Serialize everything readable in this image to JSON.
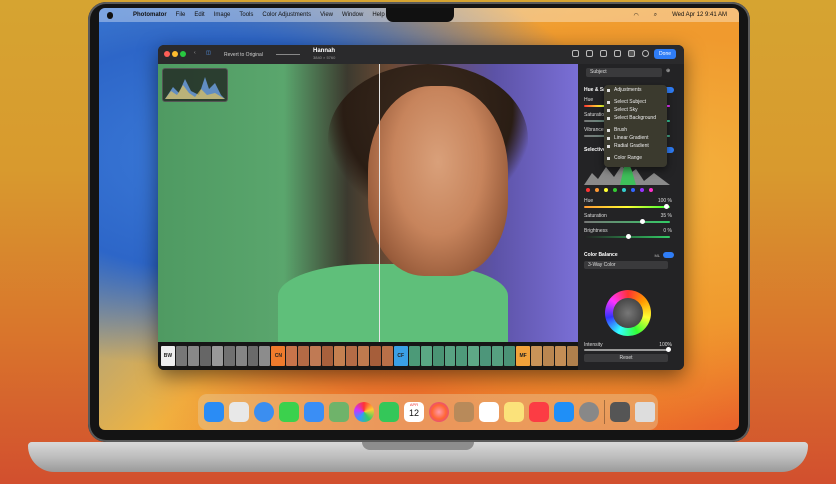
{
  "menubar": {
    "app": "Photomator",
    "items": [
      "File",
      "Edit",
      "Image",
      "Tools",
      "Color Adjustments",
      "View",
      "Window",
      "Help"
    ],
    "clock": "Wed Apr 12  9:41 AM"
  },
  "toolbar": {
    "revert": "Revert to Original",
    "photo_title": "Hannah",
    "photo_size": "3840 × 5760",
    "done": "Done"
  },
  "panel": {
    "subject": "Subject",
    "hue_saturation": "Hue & Saturation",
    "hue": "Hue",
    "saturation": "Saturation",
    "vibrance": "Vibrance",
    "ml": "ML",
    "selective_color": "Selective Color",
    "sc_hue": "Hue",
    "sc_hue_val": "100 %",
    "sc_saturation": "Saturation",
    "sc_saturation_val": "35 %",
    "sc_brightness": "Brightness",
    "sc_brightness_val": "0 %",
    "color_balance": "Color Balance",
    "three_way": "3-Way Color",
    "intensity": "Intensity",
    "intensity_val": "100%",
    "reset": "Reset"
  },
  "dropdown": {
    "items": [
      "Adjustments",
      "Select Subject",
      "Select Sky",
      "Select Background",
      "Brush",
      "Linear Gradient",
      "Radial Gradient",
      "Color Range"
    ]
  },
  "filmstrip": {
    "tags": [
      "BW",
      "CN",
      "CF",
      "MF"
    ]
  },
  "dock": {
    "calendar_month": "APR",
    "calendar_day": "12"
  }
}
